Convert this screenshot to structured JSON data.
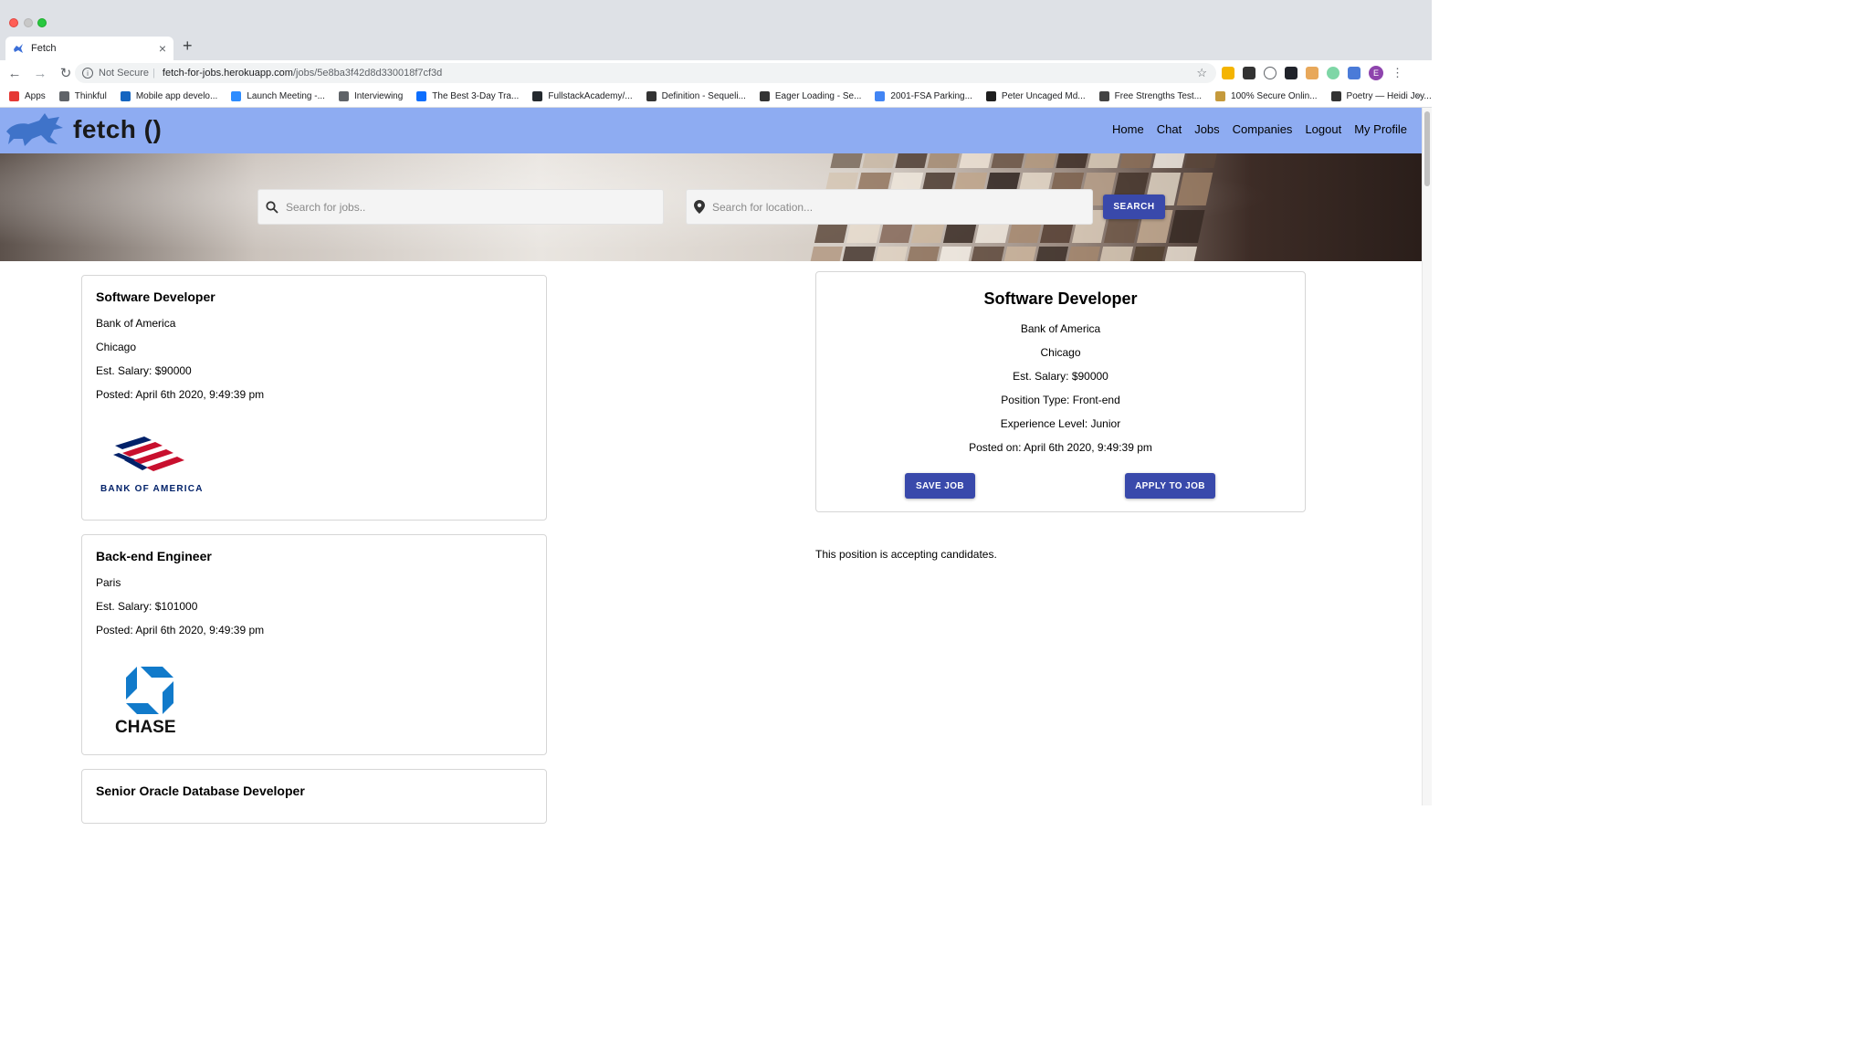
{
  "browser": {
    "tab_title": "Fetch",
    "tab_close": "×",
    "new_tab": "+",
    "security_label": "Not Secure",
    "url_host": "fetch-for-jobs.herokuapp.com",
    "url_path": "/jobs/5e8ba3f42d8d330018f7cf3d",
    "profile_initial": "E",
    "bookmarks": [
      {
        "label": "Apps",
        "icon_color": "#e53935"
      },
      {
        "label": "Thinkful",
        "icon_color": "#5f6368"
      },
      {
        "label": "Mobile app develo...",
        "icon_color": "#1565c0"
      },
      {
        "label": "Launch Meeting -...",
        "icon_color": "#2d8cff"
      },
      {
        "label": "Interviewing",
        "icon_color": "#5f6368"
      },
      {
        "label": "The Best 3-Day Tra...",
        "icon_color": "#0d6efd"
      },
      {
        "label": "FullstackAcademy/...",
        "icon_color": "#24292e"
      },
      {
        "label": "Definition - Sequeli...",
        "icon_color": "#333333"
      },
      {
        "label": "Eager Loading - Se...",
        "icon_color": "#333333"
      },
      {
        "label": "2001-FSA Parking...",
        "icon_color": "#4285f4"
      },
      {
        "label": "Peter Uncaged Md...",
        "icon_color": "#1f1f1f"
      },
      {
        "label": "Free Strengths Test...",
        "icon_color": "#444444"
      },
      {
        "label": "100% Secure Onlin...",
        "icon_color": "#c59a3c"
      },
      {
        "label": "Poetry — Heidi Joy...",
        "icon_color": "#333333"
      }
    ],
    "bookmarks_more": "»"
  },
  "app": {
    "brand": "fetch ()",
    "nav": [
      "Home",
      "Chat",
      "Jobs",
      "Companies",
      "Logout",
      "My Profile"
    ],
    "brand_color": "#8eacf2",
    "accent_color": "#3949ab"
  },
  "search": {
    "jobs_placeholder": "Search for jobs..",
    "location_placeholder": "Search for location...",
    "button": "SEARCH"
  },
  "jobs": [
    {
      "title": "Software Developer",
      "company": "Bank of America",
      "location": "Chicago",
      "salary": "Est. Salary: $90000",
      "posted": "Posted: April 6th 2020, 9:49:39 pm",
      "logo_text": "BANK OF AMERICA"
    },
    {
      "title": "Back-end Engineer",
      "location": "Paris",
      "salary": "Est. Salary: $101000",
      "posted": "Posted: April 6th 2020, 9:49:39 pm",
      "logo_text": "CHASE"
    },
    {
      "title": "Senior Oracle Database Developer"
    }
  ],
  "detail": {
    "title": "Software Developer",
    "company": "Bank of America",
    "location": "Chicago",
    "salary": "Est. Salary: $90000",
    "position_type": "Position Type: Front-end",
    "experience": "Experience Level: Junior",
    "posted": "Posted on: April 6th 2020, 9:49:39 pm",
    "save_button": "SAVE JOB",
    "apply_button": "APPLY TO JOB",
    "status": "This position is accepting candidates."
  }
}
